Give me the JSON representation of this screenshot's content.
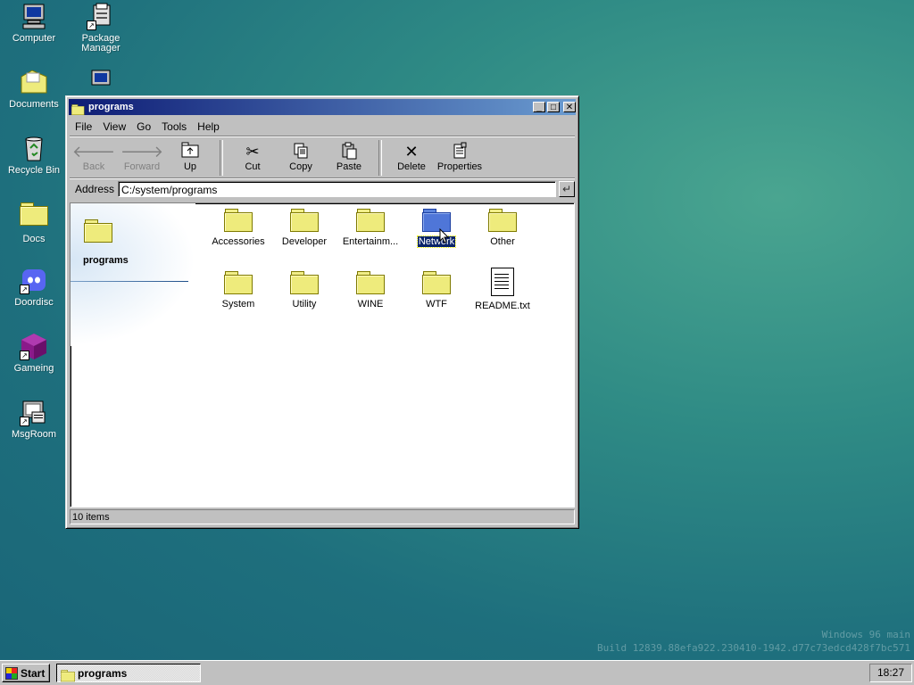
{
  "desktop": {
    "icons": [
      {
        "label": "Computer",
        "icon": "computer-icon"
      },
      {
        "label": "Package\nManager",
        "icon": "package-manager-icon"
      },
      {
        "label": "Documents",
        "icon": "documents-folder-icon"
      },
      {
        "label": "Recycle Bin",
        "icon": "recycle-bin-icon"
      },
      {
        "label": "Docs",
        "icon": "folder-icon"
      },
      {
        "label": "Doordisc",
        "icon": "discord-icon"
      },
      {
        "label": "Gameing",
        "icon": "game-cube-icon"
      },
      {
        "label": "MsgRoom",
        "icon": "msgroom-icon"
      }
    ],
    "watermark_line1": "Windows 96 main",
    "watermark_line2": "Build 12839.88efa922.230410-1942.d77c73edcd428f7bc571"
  },
  "window": {
    "title": "programs",
    "controls": {
      "minimize": "_",
      "maximize": "□",
      "close": "✕"
    },
    "menu": [
      "File",
      "View",
      "Go",
      "Tools",
      "Help"
    ],
    "toolbar": {
      "back": "Back",
      "forward": "Forward",
      "up": "Up",
      "cut": "Cut",
      "copy": "Copy",
      "paste": "Paste",
      "delete": "Delete",
      "properties": "Properties"
    },
    "address_label": "Address",
    "address_value": "C:/system/programs",
    "side_title": "programs",
    "items": [
      {
        "label": "Accessories",
        "type": "folder"
      },
      {
        "label": "Developer",
        "type": "folder"
      },
      {
        "label": "Entertainm...",
        "type": "folder"
      },
      {
        "label": "Network",
        "type": "folder",
        "selected": true
      },
      {
        "label": "Other",
        "type": "folder"
      },
      {
        "label": "System",
        "type": "folder"
      },
      {
        "label": "Utility",
        "type": "folder"
      },
      {
        "label": "WINE",
        "type": "folder"
      },
      {
        "label": "WTF",
        "type": "folder"
      },
      {
        "label": "README.txt",
        "type": "text-file"
      }
    ],
    "status": "10 items"
  },
  "taskbar": {
    "start_label": "Start",
    "task_label": "programs",
    "clock": "18:27"
  },
  "colors": {
    "desktop_teal": "#1e6f7d",
    "title_active_start": "#0d1b74",
    "selection": "#0a246a",
    "folder_yellow": "#eeeb7c",
    "folder_selected_blue": "#4f76d8"
  }
}
